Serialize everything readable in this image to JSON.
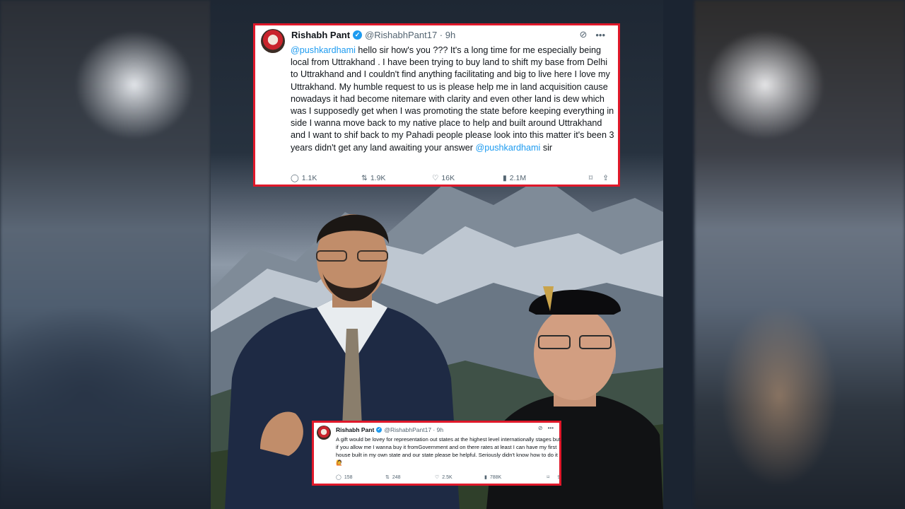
{
  "tweet_main": {
    "name": "Rishabh Pant",
    "handle": "@RishabhPant17 · 9h",
    "mention_start": "@pushkardhami",
    "text": " hello sir how's you ???  It's a long time for me especially being local from Uttrakhand . I have been trying to buy land to shift my base from Delhi to Uttrakhand and I couldn't find anything facilitating and big to live here I love my Uttrakhand. My humble request to us is please help me in land acquisition cause nowadays it had become nitemare with clarity and even other  land is dew which was I supposedly get when I was promoting the state  before keeping everything in side I wanna move back to my native place to help and built around Uttrakhand and I want to shif back to my Pahadi people please look into this matter it's been 3 years didn't get any land awaiting your answer ",
    "mention_end": "@pushkardhami",
    "text_end": "  sir",
    "replies": "1.1K",
    "retweets": "1.9K",
    "likes": "16K",
    "views": "2.1M"
  },
  "tweet_small": {
    "name": "Rishabh Pant",
    "handle": "@RishabhPant17 · 9h",
    "text": "A gift would be lovey for representation out states at the highest level internationally stages but if you allow me I wanna buy it fromGovernment and on there  rates at least I can have my first house built in my own state and our state please be helpful.  Seriously didn't know how to do it 🙋",
    "replies": "158",
    "retweets": "248",
    "likes": "2.5K",
    "views": "788K"
  },
  "icons": {
    "verified": "verified-badge-icon",
    "grok": "grok-icon",
    "more": "more-icon",
    "reply": "reply-icon",
    "retweet": "retweet-icon",
    "like": "like-icon",
    "views": "views-icon",
    "bookmark": "bookmark-icon",
    "share": "share-icon"
  },
  "colors": {
    "border": "#e0182a",
    "link": "#1d9bf0",
    "muted": "#536471"
  }
}
